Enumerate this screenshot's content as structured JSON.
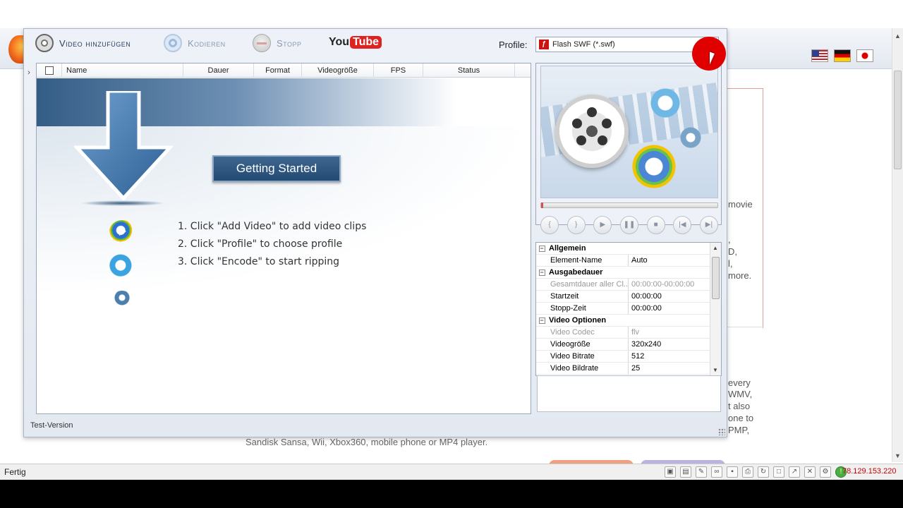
{
  "background_page": {
    "right_text_lines": [
      "movie",
      ",",
      "D,",
      "l,",
      "more."
    ],
    "right_text_lines2": [
      "every",
      "WMV,",
      "t also",
      "one to",
      "PMP,"
    ],
    "caption": "Sandisk Sansa, Wii, Xbox360, mobile phone or MP4 player."
  },
  "app": {
    "toolbar": {
      "add_video_label": "Video hinzufügen",
      "encode_label": "Kodieren",
      "stop_label": "Stopp",
      "youtube_you": "You",
      "youtube_tube": "Tube",
      "profile_label": "Profile:",
      "profile_value": "Flash SWF (*.swf)"
    },
    "list": {
      "columns": [
        "Name",
        "Dauer",
        "Format",
        "Videogröße",
        "FPS",
        "Status"
      ],
      "getting_started_label": "Getting Started",
      "steps": [
        "1. Click \"Add Video\" to add video clips",
        "2. Click \"Profile\" to choose profile",
        "3. Click \"Encode\" to start ripping"
      ]
    },
    "player_controls": [
      "{",
      "}",
      "▶",
      "❚❚",
      "■",
      "|◀",
      "▶|"
    ],
    "properties": [
      {
        "type": "category",
        "name": "Allgemein"
      },
      {
        "type": "prop",
        "name": "Element-Name",
        "value": "Auto",
        "dim": false
      },
      {
        "type": "category",
        "name": "Ausgabedauer"
      },
      {
        "type": "prop",
        "name": "Gesamtdauer aller Cl...",
        "value": "00:00:00-00:00:00",
        "dim": true
      },
      {
        "type": "prop",
        "name": "Startzeit",
        "value": "00:00:00",
        "dim": false
      },
      {
        "type": "prop",
        "name": "Stopp-Zeit",
        "value": "00:00:00",
        "dim": false
      },
      {
        "type": "category",
        "name": "Video Optionen"
      },
      {
        "type": "prop",
        "name": "Video Codec",
        "value": "flv",
        "dim": true
      },
      {
        "type": "prop",
        "name": "Videogröße",
        "value": "320x240",
        "dim": false
      },
      {
        "type": "prop",
        "name": "Video Bitrate",
        "value": "512",
        "dim": false
      },
      {
        "type": "prop",
        "name": "Video Bildrate",
        "value": "25",
        "dim": false
      }
    ],
    "status_text": "Test-Version"
  },
  "browser_status": {
    "text": "Fertig",
    "ip": "78.129.153.220"
  },
  "colors": {
    "accent": "#234a72",
    "cursor_highlight": "#e00000",
    "status_ip": "#cc0000"
  }
}
